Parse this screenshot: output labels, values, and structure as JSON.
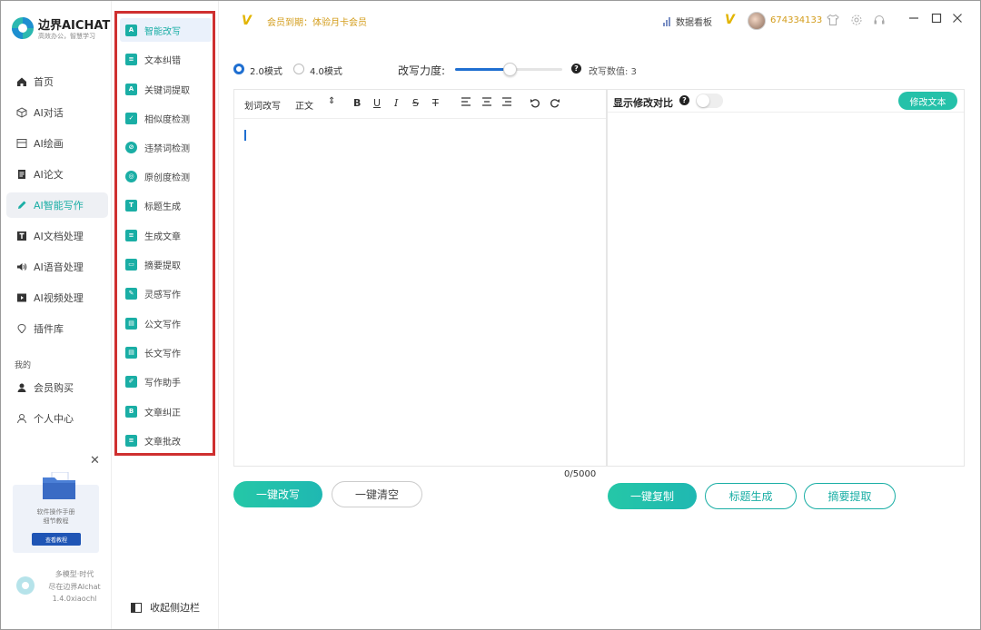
{
  "app": {
    "name": "边界AICHAT",
    "tagline": "高效办公，智慧学习"
  },
  "nav": {
    "items": [
      {
        "label": "首页",
        "icon": "home-icon"
      },
      {
        "label": "AI对话",
        "icon": "cube-icon"
      },
      {
        "label": "AI绘画",
        "icon": "picture-icon"
      },
      {
        "label": "AI论文",
        "icon": "document-icon"
      },
      {
        "label": "AI智能写作",
        "icon": "pen-icon",
        "active": true
      },
      {
        "label": "AI文档处理",
        "icon": "text-doc-icon"
      },
      {
        "label": "AI语音处理",
        "icon": "speaker-icon"
      },
      {
        "label": "AI视频处理",
        "icon": "video-icon"
      },
      {
        "label": "插件库",
        "icon": "plugin-icon"
      }
    ],
    "section_label": "我的",
    "personal": [
      {
        "label": "会员购买",
        "icon": "user-icon"
      },
      {
        "label": "个人中心",
        "icon": "user-outline-icon"
      }
    ]
  },
  "promo": {
    "line1": "软件操作手册",
    "line2": "细节教程",
    "button": "查看教程"
  },
  "footer": {
    "line1": "多模型·时代",
    "line2": "尽在边界AIchat",
    "version": "1.4.0xiaochl"
  },
  "submenu": {
    "items": [
      {
        "label": "智能改写",
        "glyph": "A",
        "active": true
      },
      {
        "label": "文本纠错",
        "glyph": "≡"
      },
      {
        "label": "关键词提取",
        "glyph": "A"
      },
      {
        "label": "相似度检测",
        "glyph": "✓"
      },
      {
        "label": "违禁词检测",
        "glyph": "⊘"
      },
      {
        "label": "原创度检测",
        "glyph": "◎"
      },
      {
        "label": "标题生成",
        "glyph": "T"
      },
      {
        "label": "生成文章",
        "glyph": "≡"
      },
      {
        "label": "摘要提取",
        "glyph": "▭"
      },
      {
        "label": "灵感写作",
        "glyph": "✎"
      },
      {
        "label": "公文写作",
        "glyph": "▤"
      },
      {
        "label": "长文写作",
        "glyph": "▤"
      },
      {
        "label": "写作助手",
        "glyph": "✐"
      },
      {
        "label": "文章纠正",
        "glyph": "B"
      },
      {
        "label": "文章批改",
        "glyph": "≡"
      }
    ],
    "collapse_label": "收起侧边栏"
  },
  "topbar": {
    "vip_status": "会员到期：体验月卡会员",
    "dashboard": "数据看板",
    "user_id": "674334133"
  },
  "rewrite": {
    "mode1": "2.0模式",
    "mode2": "4.0模式",
    "strength_label": "改写力度:",
    "strength_value_label": "改写数值: 3",
    "strength_value": 3,
    "strength_max": 5,
    "toolbar": {
      "select_rewrite": "划词改写",
      "format": "正文",
      "bold": "B",
      "underline": "U",
      "italic": "I",
      "strike": "S",
      "clear": "T"
    },
    "counter": "0/5000",
    "compare_label": "显示修改对比",
    "edit_button": "修改文本",
    "btn_rewrite": "一键改写",
    "btn_clear": "一键清空",
    "btn_copy": "一键复制",
    "btn_title": "标题生成",
    "btn_summary": "摘要提取"
  },
  "colors": {
    "accent": "#1aaea5",
    "highlight_box": "#cf3030",
    "vip_gold": "#d39c1a"
  }
}
